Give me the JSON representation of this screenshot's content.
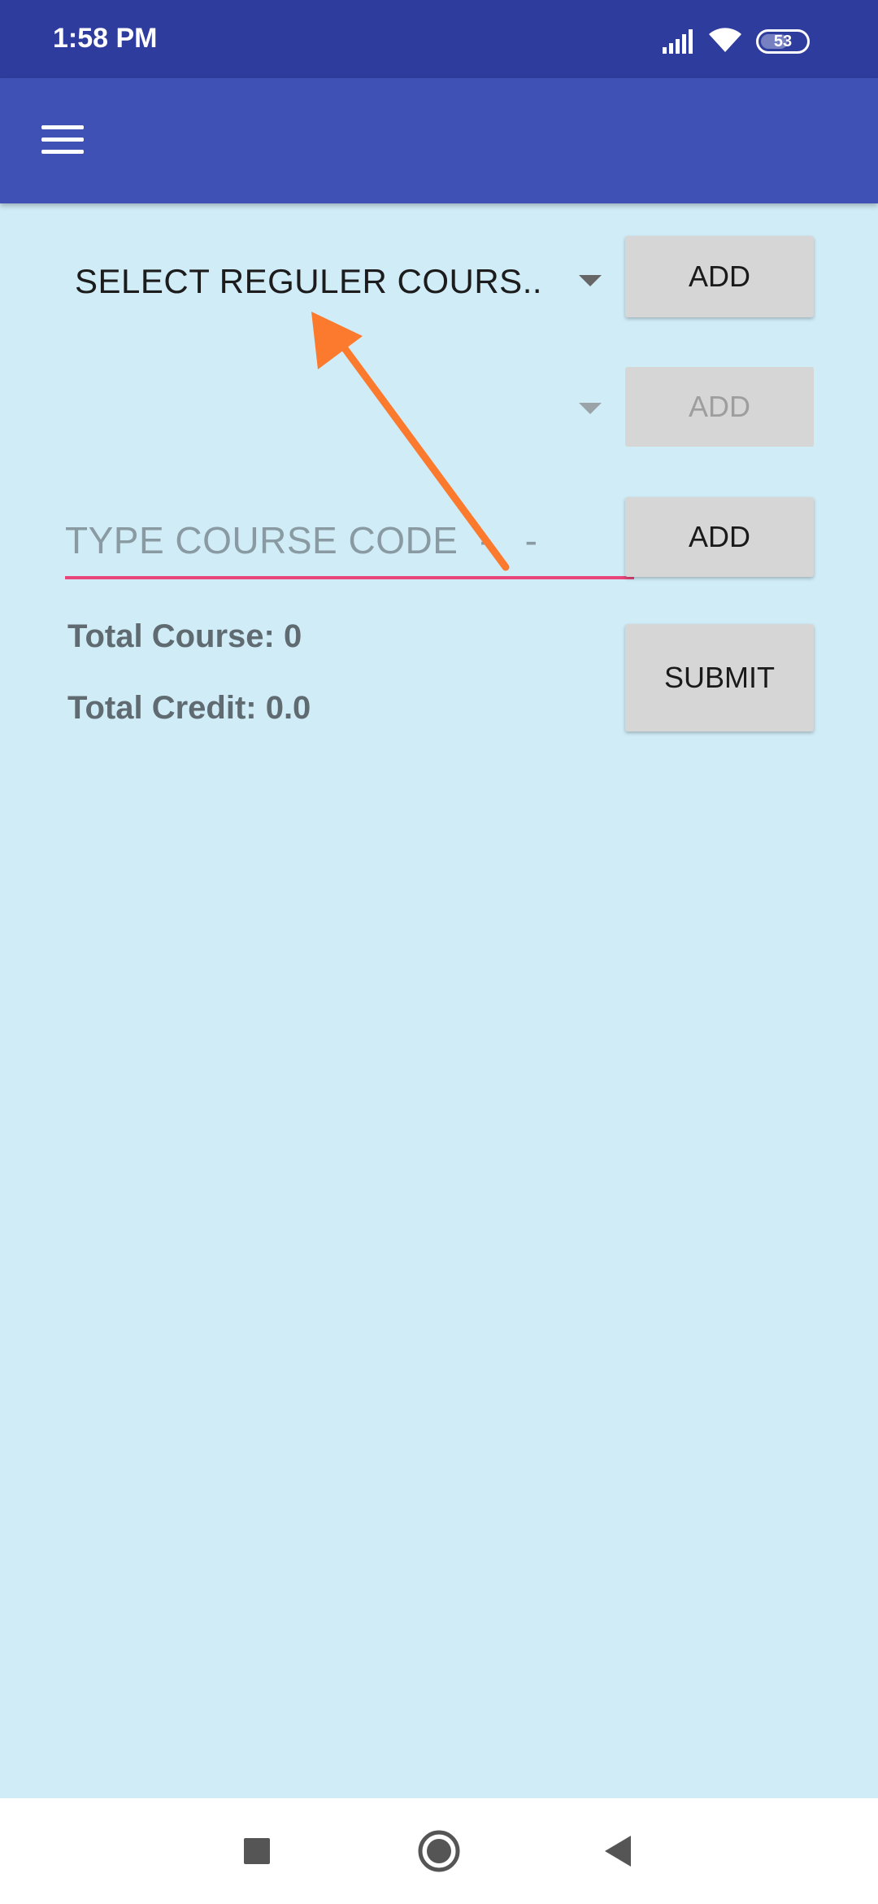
{
  "status_bar": {
    "time": "1:58 PM",
    "battery": "53",
    "icons": [
      "signal-icon",
      "wifi-icon",
      "battery-icon"
    ]
  },
  "app_bar": {
    "menu_icon": "hamburger-menu-icon"
  },
  "form": {
    "regular_course_spinner": "SELECT REGULER COURS..",
    "second_spinner": "",
    "add_label_1": "ADD",
    "add_label_2": "ADD",
    "add_label_3": "ADD",
    "course_code_placeholder": "TYPE COURSE CODE  -   -",
    "course_code_value": "",
    "submit_label": "SUBMIT",
    "total_course": "Total Course: 0",
    "total_credit": "Total Credit: 0.0"
  },
  "nav_bar": {
    "icons": [
      "recents-square-icon",
      "home-circle-icon",
      "back-triangle-icon"
    ]
  },
  "colors": {
    "status_bar": "#2e3c9e",
    "app_bar": "#3f51b5",
    "background": "#d0ecf7",
    "input_underline": "#e8457a",
    "annotation_arrow": "#fb7a2e"
  }
}
